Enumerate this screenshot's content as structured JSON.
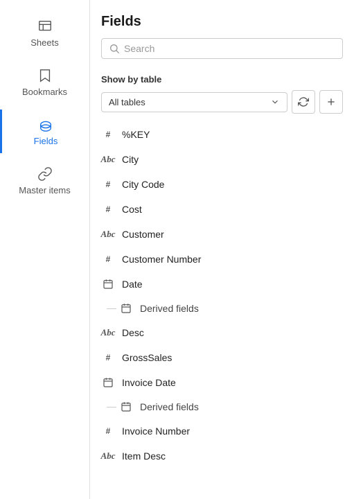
{
  "sidebar": {
    "items": [
      {
        "id": "sheets",
        "label": "Sheets",
        "icon": "sheets-icon"
      },
      {
        "id": "bookmarks",
        "label": "Bookmarks",
        "icon": "bookmarks-icon"
      },
      {
        "id": "fields",
        "label": "Fields",
        "icon": "fields-icon",
        "active": true
      },
      {
        "id": "master-items",
        "label": "Master items",
        "icon": "master-items-icon"
      }
    ]
  },
  "main": {
    "title": "Fields",
    "search": {
      "placeholder": "Search",
      "value": ""
    },
    "show_by_table": {
      "label": "Show by table",
      "selected": "All tables"
    },
    "buttons": {
      "refresh": "↺",
      "add": "+"
    },
    "fields": [
      {
        "name": "%KEY",
        "type": "number",
        "has_derived": false
      },
      {
        "name": "City",
        "type": "string",
        "has_derived": false
      },
      {
        "name": "City Code",
        "type": "number",
        "has_derived": false
      },
      {
        "name": "Cost",
        "type": "number",
        "has_derived": false
      },
      {
        "name": "Customer",
        "type": "string",
        "has_derived": false
      },
      {
        "name": "Customer Number",
        "type": "number",
        "has_derived": false
      },
      {
        "name": "Date",
        "type": "date",
        "has_derived": true,
        "derived_label": "Derived fields"
      },
      {
        "name": "Desc",
        "type": "string",
        "has_derived": false
      },
      {
        "name": "GrossSales",
        "type": "number",
        "has_derived": false
      },
      {
        "name": "Invoice Date",
        "type": "date",
        "has_derived": true,
        "derived_label": "Derived fields"
      },
      {
        "name": "Invoice Number",
        "type": "number",
        "has_derived": false
      },
      {
        "name": "Item Desc",
        "type": "string",
        "has_derived": false
      }
    ]
  }
}
